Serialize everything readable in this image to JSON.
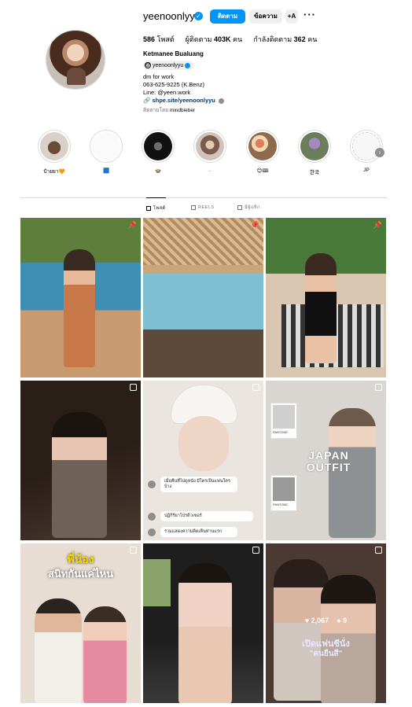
{
  "profile": {
    "username": "yeenoonlyyu",
    "follow_label": "ติดตาม",
    "message_label": "ข้อความ",
    "suggest_label": "+A",
    "posts_count": "586",
    "posts_label": "โพสต์",
    "followers_prefix": "ผู้ติดตาม",
    "followers_count": "403K",
    "followers_suffix": "คน",
    "following_prefix": "กำลังติดตาม",
    "following_count": "362",
    "following_suffix": "คน",
    "full_name": "Ketmanee Bualuang",
    "threads_handle": "yeenoonlyyu",
    "bio_line1": "dm for work",
    "bio_line2": "063-625-9225 (K.Benz)",
    "bio_line3": "Line: @yeen.work",
    "bio_link": "shpe.site/yeenoonlyyu",
    "followed_by_prefix": "ติดตามโดย",
    "followed_by_name": "mindbieber"
  },
  "highlights": [
    {
      "label": "ป้ายยา🧡",
      "icon": "dog-photo"
    },
    {
      "label": "🟦",
      "icon": "white-photo"
    },
    {
      "label": "🍲",
      "icon": "dark-concert-photo"
    },
    {
      "label": ".",
      "icon": "portrait-photo"
    },
    {
      "label": "😊🎟",
      "icon": "food-photo"
    },
    {
      "label": "한국",
      "icon": "flower-photo"
    },
    {
      "label": "JP",
      "icon": "sketch-photo"
    }
  ],
  "tabs": [
    {
      "label": "โพสต์",
      "icon": "grid-icon"
    },
    {
      "label": "REELS",
      "icon": "reels-icon"
    },
    {
      "label": "มีผู้แท็ก",
      "icon": "tagged-icon"
    }
  ],
  "grid": {
    "cell4_chat": [
      "เมื่อคืนที่ไปดูหนัง มีใครเป็นแฟนใครบ้าง",
      "ปฏิกิริยาโปรดิวเซอร์",
      "ร่วมแสดงความคิดเห็นท่านแรก"
    ],
    "cell6_title": "JAPAN OUTFIT",
    "cell6_swatch": "PANTONE",
    "cell7_title1": "พี่น้อง",
    "cell7_title2": "สนิทกันแค่ไหน",
    "cell9_likes": "2,067",
    "cell9_comments": "9",
    "cell9_caption1": "เปิดแฟนซีนั่ง",
    "cell9_caption2": "\"คนยืนสี\""
  }
}
